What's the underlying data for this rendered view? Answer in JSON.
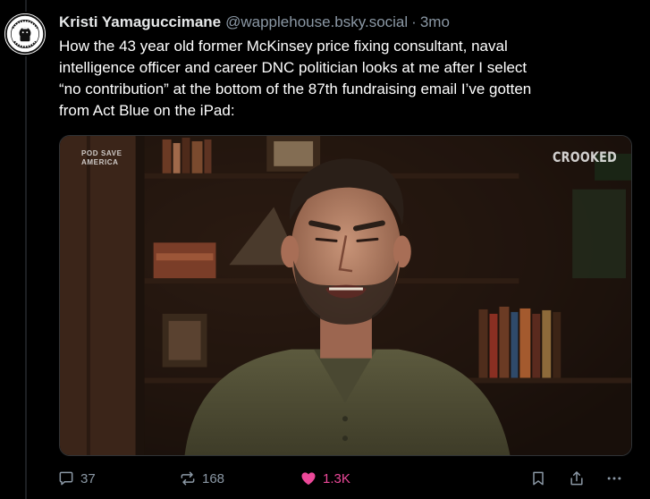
{
  "post": {
    "author": {
      "display_name": "Kristi Yamaguccimane",
      "handle": "@wapplehouse.bsky.social",
      "separator": "·",
      "timestamp": "3mo",
      "avatar_icon": "waffle-house-logo-avatar"
    },
    "text": "How the 43 year old former McKinsey price fixing consultant, naval\nintelligence officer and career DNC politician looks at me after I select\n“no contribution” at the bottom of the 87th fundraising email I’ve gotten\nfrom Act Blue on the iPad:",
    "media": {
      "watermark_left": "POD SAVE\nAMERICA",
      "watermark_right": "CROOKED"
    },
    "actions": {
      "reply": {
        "icon": "reply-icon",
        "count": "37"
      },
      "repost": {
        "icon": "repost-icon",
        "count": "168"
      },
      "like": {
        "icon": "heart-icon",
        "count": "1.3K",
        "color": "#ec4899"
      },
      "bookmark": {
        "icon": "bookmark-icon"
      },
      "share": {
        "icon": "share-icon"
      },
      "more": {
        "icon": "more-icon"
      }
    }
  },
  "colors": {
    "background": "#000000",
    "text": "#e7e9ea",
    "muted": "#8b98a5",
    "like": "#ec4899"
  }
}
